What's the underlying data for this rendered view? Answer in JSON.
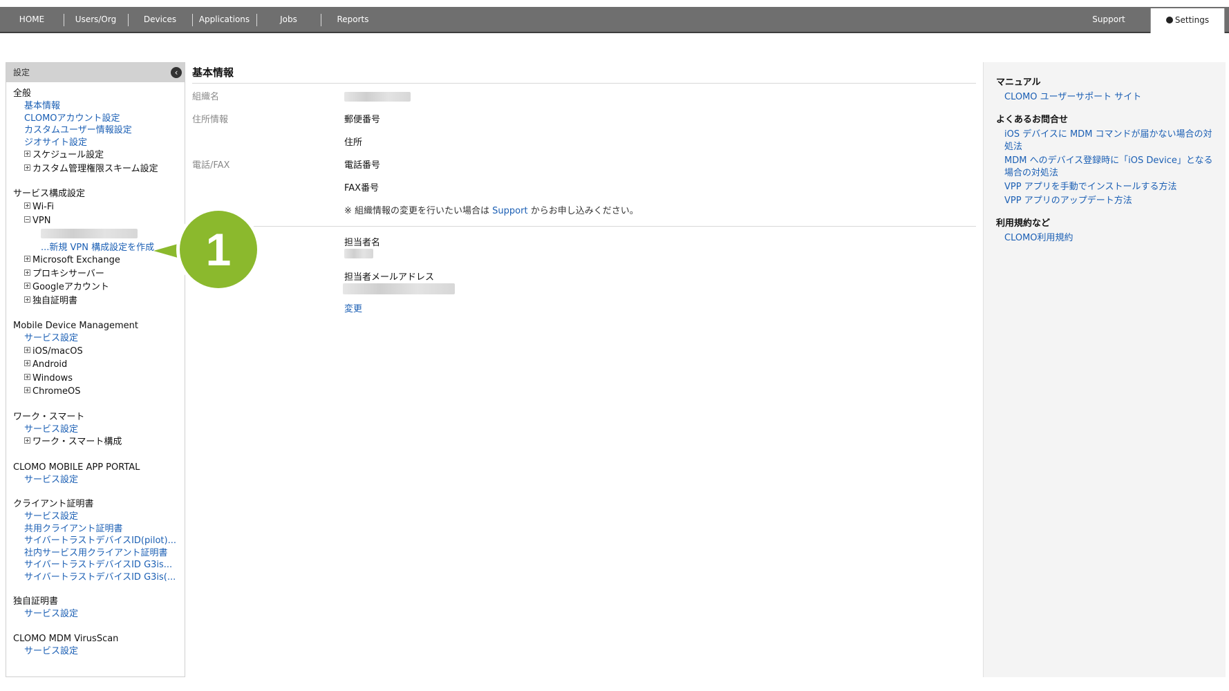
{
  "nav": {
    "items": [
      "HOME",
      "Users/Org",
      "Devices",
      "Applications",
      "Jobs",
      "Reports"
    ],
    "support": "Support",
    "settings": "Settings"
  },
  "sidebar": {
    "header": "設定",
    "sections": {
      "general": {
        "title": "全般",
        "links": [
          "基本情報",
          "CLOMOアカウント設定",
          "カスタムユーザー情報設定",
          "ジオサイト設定"
        ],
        "tree": [
          "スケジュール設定",
          "カスタム管理権限スキーム設定"
        ]
      },
      "service": {
        "title": "サービス構成設定",
        "wifi": "Wi-Fi",
        "vpn": "VPN",
        "new_vpn": "...新規 VPN 構成設定を作成",
        "tree": [
          "Microsoft Exchange",
          "プロキシサーバー",
          "Googleアカウント",
          "独自証明書"
        ]
      },
      "mdm": {
        "title": "Mobile Device Management",
        "link": "サービス設定",
        "tree": [
          "iOS/macOS",
          "Android",
          "Windows",
          "ChromeOS"
        ]
      },
      "work": {
        "title": "ワーク・スマート",
        "link": "サービス設定",
        "tree": [
          "ワーク・スマート構成"
        ]
      },
      "portal": {
        "title": "CLOMO MOBILE APP PORTAL",
        "link": "サービス設定"
      },
      "client_cert": {
        "title": "クライアント証明書",
        "links": [
          "サービス設定",
          "共用クライアント証明書",
          "サイバートラストデバイスID(pilot)...",
          "社内サービス用クライアント証明書",
          "サイバートラストデバイスID G3is...",
          "サイバートラストデバイスID G3is(..."
        ]
      },
      "own_cert": {
        "title": "独自証明書",
        "link": "サービス設定"
      },
      "virusscan": {
        "title": "CLOMO MDM VirusScan",
        "link": "サービス設定"
      }
    }
  },
  "main": {
    "title": "基本情報",
    "org_name_label": "組織名",
    "address_label": "住所情報",
    "postal_label": "郵便番号",
    "address_field_label": "住所",
    "phone_label": "電話/FAX",
    "phone_field_label": "電話番号",
    "fax_field_label": "FAX番号",
    "note_prefix": "※ 組織情報の変更を行いたい場合は ",
    "note_link": "Support",
    "note_suffix": " からお申し込みください。",
    "contact_name_label": "担当者名",
    "contact_email_label": "担当者メールアドレス",
    "change_link": "変更"
  },
  "right": {
    "manual_title": "マニュアル",
    "manual_link": "CLOMO ユーザーサポート サイト",
    "faq_title": "よくあるお問合せ",
    "faq_links": [
      "iOS デバイスに MDM コマンドが届かない場合の対処法",
      "MDM へのデバイス登録時に「iOS Device」となる場合の対処法",
      "VPP アプリを手動でインストールする方法",
      "VPP アプリのアップデート方法"
    ],
    "terms_title": "利用規約など",
    "terms_link": "CLOMO利用規約"
  },
  "callout": {
    "number": "1",
    "color": "#8bb92d"
  }
}
